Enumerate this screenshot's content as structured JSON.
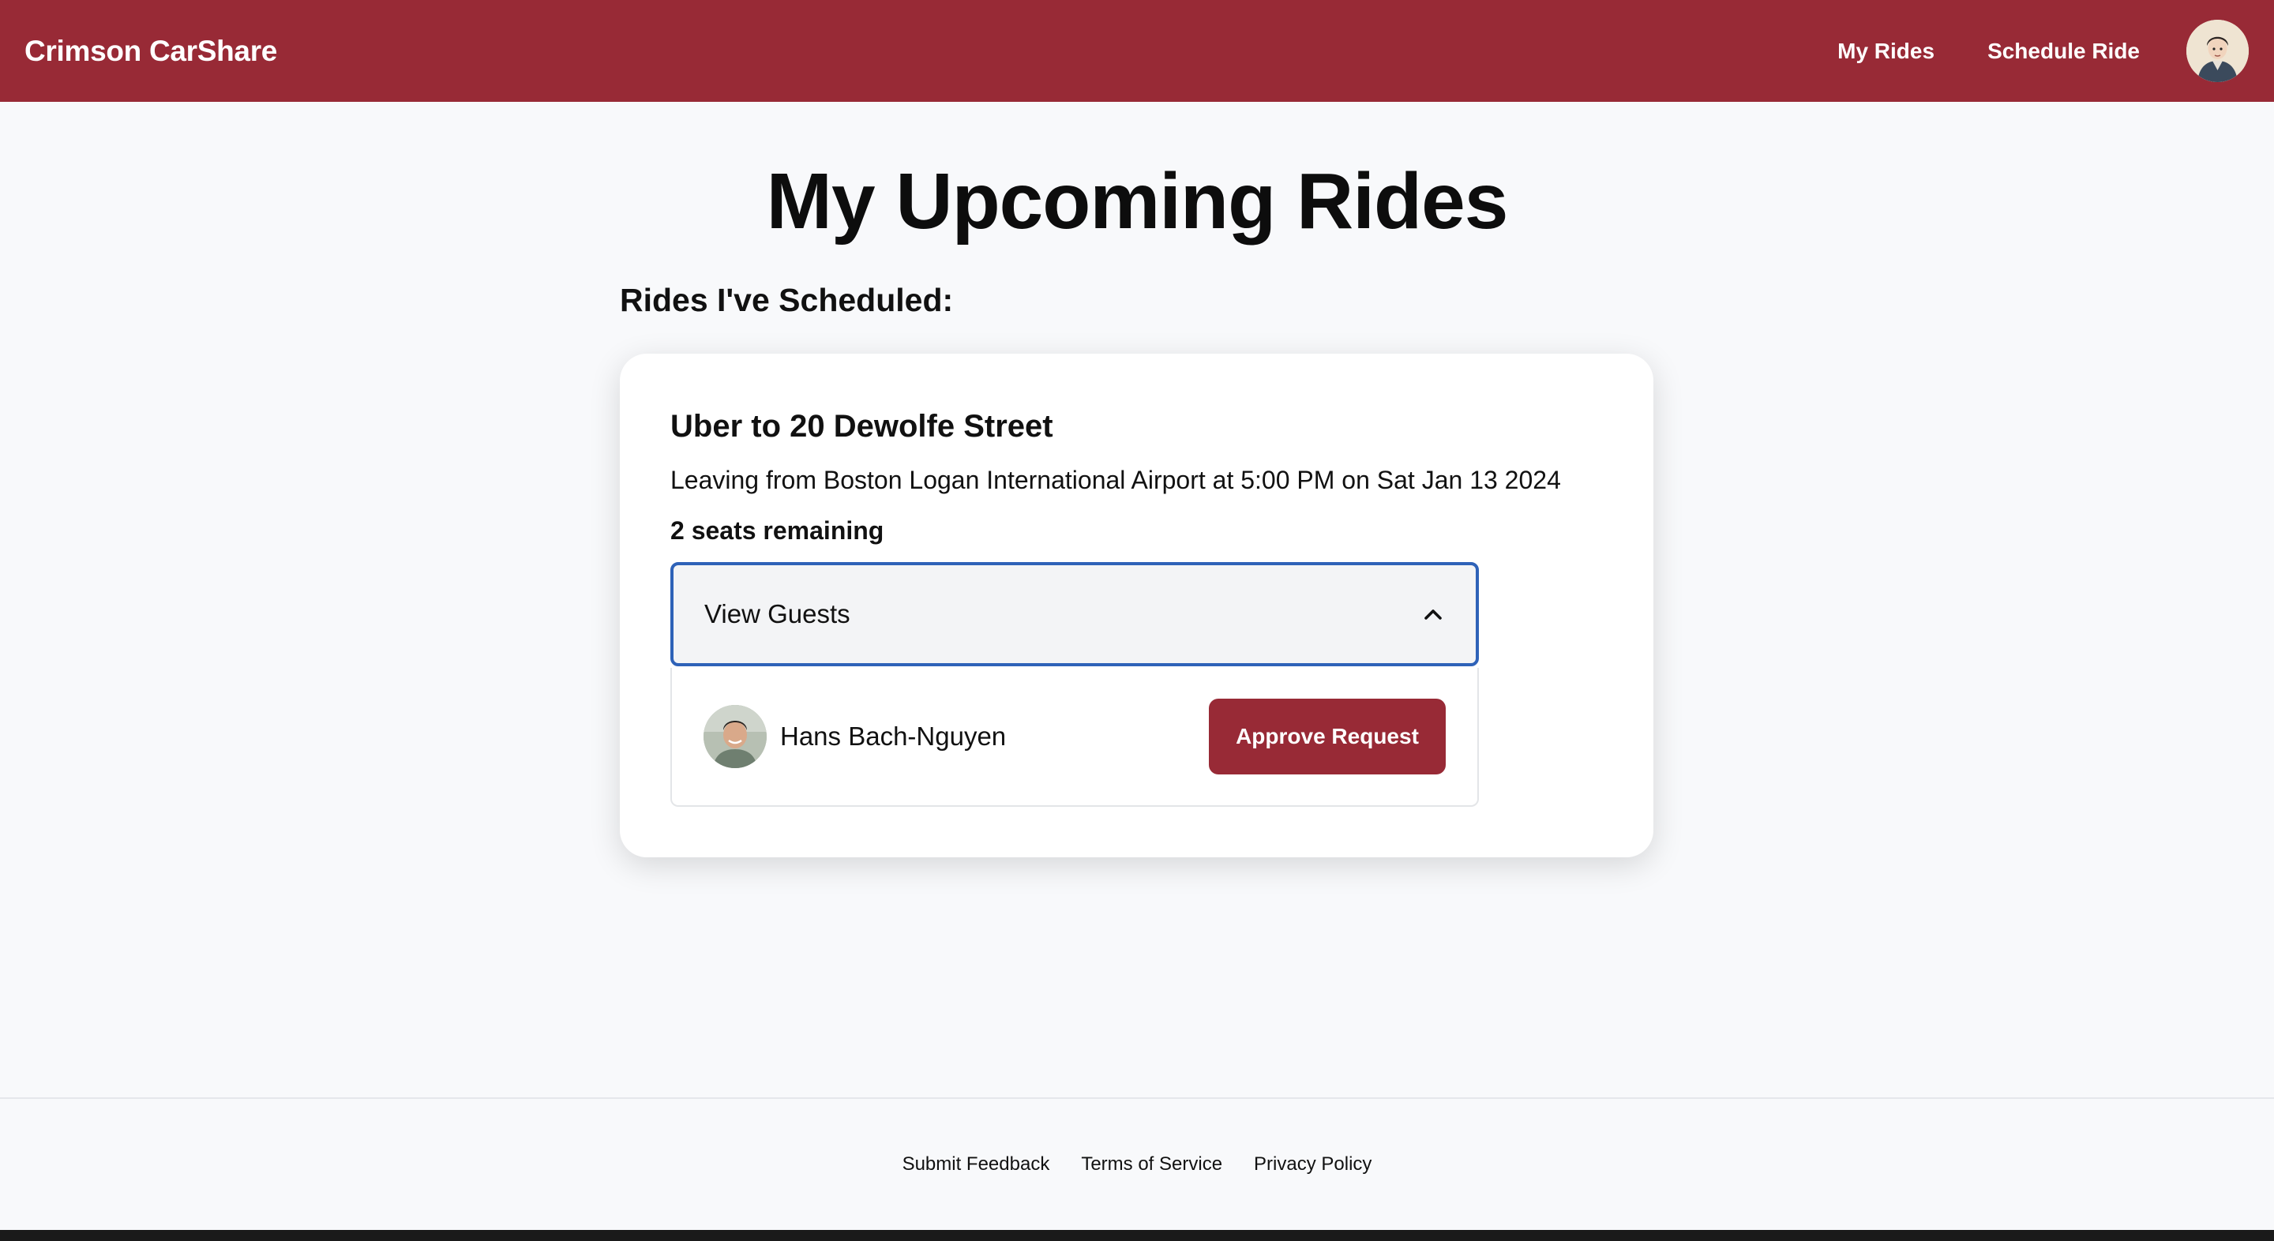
{
  "navbar": {
    "brand": "Crimson CarShare",
    "links": [
      {
        "label": "My Rides"
      },
      {
        "label": "Schedule Ride"
      }
    ],
    "avatar_icon": "user-avatar",
    "background_color": "#982a36"
  },
  "main": {
    "title": "My Upcoming Rides",
    "section_heading": "Rides I've Scheduled:",
    "rides": [
      {
        "title": "Uber to 20 Dewolfe Street",
        "details": "Leaving from Boston Logan International Airport at 5:00 PM on Sat Jan 13 2024",
        "seats": "2 seats remaining",
        "guests_toggle": {
          "label": "View Guests",
          "expanded": true,
          "icon": "chevron-up-icon"
        },
        "guests": [
          {
            "name": "Hans Bach-Nguyen",
            "action_label": "Approve Request"
          }
        ]
      }
    ]
  },
  "footer": {
    "links": [
      {
        "label": "Submit Feedback"
      },
      {
        "label": "Terms of Service"
      },
      {
        "label": "Privacy Policy"
      }
    ]
  },
  "colors": {
    "accent": "#982a36",
    "focus_border": "#2e62b8",
    "page_background": "#f8f9fb"
  }
}
